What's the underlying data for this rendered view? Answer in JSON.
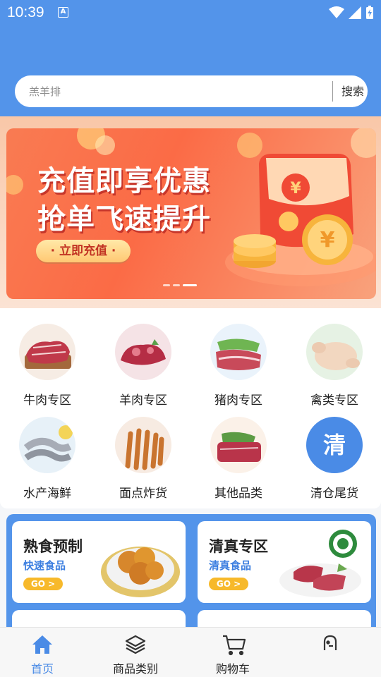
{
  "status_bar": {
    "time": "10:39",
    "notif_letter": "A"
  },
  "search": {
    "placeholder": "羔羊排",
    "button_label": "搜索"
  },
  "banner": {
    "headline_line1": "充值即享优惠",
    "headline_line2": "抢单飞速提升",
    "cta_label": "· 立即充值 ·",
    "currency_symbol": "¥"
  },
  "categories": [
    {
      "label": "牛肉专区",
      "icon": "beef-icon"
    },
    {
      "label": "羊肉专区",
      "icon": "lamb-icon"
    },
    {
      "label": "猪肉专区",
      "icon": "pork-icon"
    },
    {
      "label": "禽类专区",
      "icon": "poultry-icon"
    },
    {
      "label": "水产海鲜",
      "icon": "seafood-icon"
    },
    {
      "label": "面点炸货",
      "icon": "fried-dough-icon"
    },
    {
      "label": "其他品类",
      "icon": "other-meat-icon"
    },
    {
      "label": "清仓尾货",
      "icon": "clearance-icon",
      "badge_text": "清"
    }
  ],
  "promos": [
    {
      "title": "熟食预制",
      "subtitle": "快速食品",
      "go_label": "GO >"
    },
    {
      "title": "清真专区",
      "subtitle": "清真食品",
      "go_label": "GO >"
    }
  ],
  "tabs": [
    {
      "label": "首页",
      "icon": "home-icon",
      "active": true
    },
    {
      "label": "商品类别",
      "icon": "layers-icon",
      "active": false
    },
    {
      "label": "购物车",
      "icon": "cart-icon",
      "active": false
    },
    {
      "label": "",
      "icon": "profile-icon",
      "active": false
    }
  ],
  "colors": {
    "primary": "#5394ea",
    "active_tab": "#4a8be6",
    "banner_orange": "#fb6b46",
    "go_badge": "#f7b92b"
  }
}
